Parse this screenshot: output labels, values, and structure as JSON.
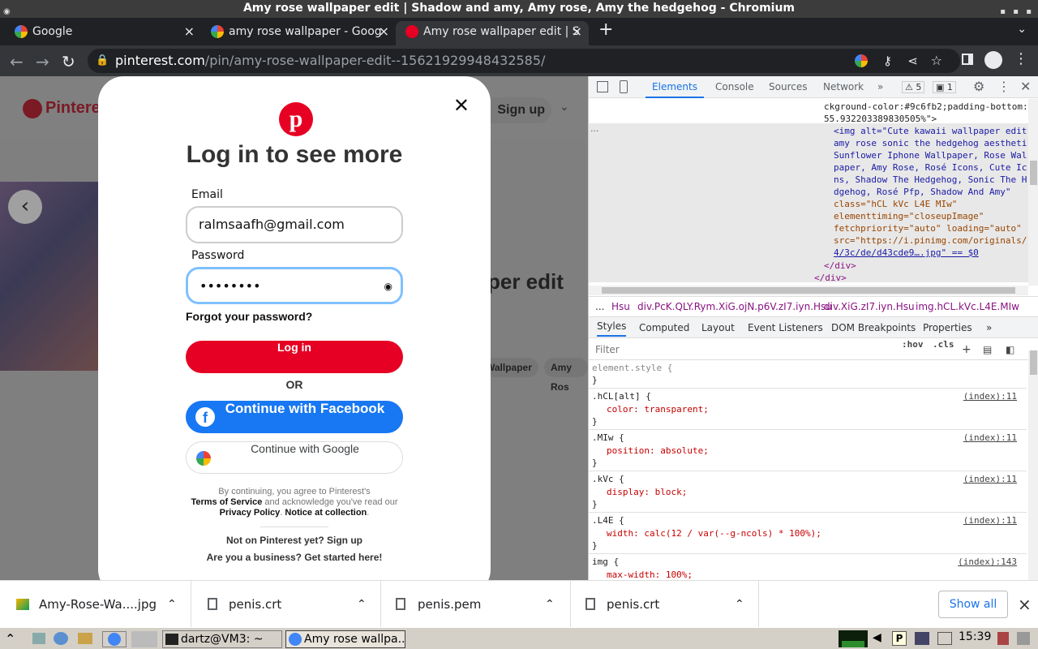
{
  "window": {
    "title": "Amy rose wallpaper edit | Shadow and amy, Amy rose, Amy the hedgehog - Chromium"
  },
  "tabs": [
    {
      "label": "Google",
      "close": "×"
    },
    {
      "label": "amy rose wallpaper - Goog",
      "close": "×"
    },
    {
      "label": "Amy rose wallpaper edit | S",
      "close": "×"
    }
  ],
  "toolbar": {
    "new_tab": "+",
    "url_domain": "pinterest.com",
    "url_path": "/pin/amy-rose-wallpaper-edit--15621929948432585/"
  },
  "page": {
    "brand": "Pinterest",
    "signup_button": "Sign up",
    "pin_title_fragment": "per edit",
    "chip_1": "Wallpaper",
    "chip_2": "Amy Ros"
  },
  "modal": {
    "close": "✕",
    "title": "Log in to see more",
    "email_label": "Email",
    "email_value": "ralmsaafh@gmail.com",
    "password_label": "Password",
    "password_value": "••••••••",
    "forgot": "Forgot your password?",
    "login_button": "Log in",
    "or": "OR",
    "facebook_button": "Continue with Facebook",
    "google_button": "Continue with Google",
    "terms_1": "By continuing, you agree to Pinterest's",
    "terms_2a": "Terms of Service",
    "terms_2b": " and acknowledge you've read our",
    "terms_3a": "Privacy Policy",
    "terms_3b": ". ",
    "terms_3c": "Notice at collection",
    "terms_3d": ".",
    "not_on": "Not on Pinterest yet? Sign up",
    "business": "Are you a business? Get started here!"
  },
  "devtools": {
    "tabs": [
      "Elements",
      "Console",
      "Sources",
      "Network"
    ],
    "more": "»",
    "warnings": "5",
    "issues": "1",
    "code_lines": [
      "ckground-color:#9c6fb2;padding-bottom:",
      "55.932203389830505%\">",
      "<img alt=\"Cute kawaii wallpaper edit",
      "amy rose sonic the hedgehog aestheti",
      "Sunflower Iphone Wallpaper, Rose Wal",
      "paper, Amy Rose, Rosé Icons, Cute Ic",
      "ns, Shadow The Hedgehog, Sonic The H",
      "dgehog, Rosé Pfp, Shadow And Amy\"",
      "class=\"hCL kVc L4E MIw\"",
      "elementtiming=\"closeupImage\"",
      "fetchpriority=\"auto\" loading=\"auto\"",
      "src=\"https://i.pinimg.com/originals/",
      "4/3c/de/d43cde9….jpg\" == $0",
      "</div>",
      "</div>"
    ],
    "breadcrumbs": [
      "... ",
      "Hsu",
      "div.PcK.QLY.Rym.XiG.ojN.p6V.zI7.iyn.Hsu",
      "div.XiG.zI7.iyn.Hsu",
      "img.hCL.kVc.L4E.MIw"
    ],
    "panel_tabs": [
      "Styles",
      "Computed",
      "Layout",
      "Event Listeners",
      "DOM Breakpoints",
      "Properties"
    ],
    "filter_placeholder": "Filter",
    "hov": ":hov",
    "cls": ".cls",
    "rules": [
      {
        "selector": "element.style {",
        "prop": "",
        "src": ""
      },
      {
        "selector": ".hCL[alt] {",
        "prop": "color: transparent;",
        "src": "(index):11"
      },
      {
        "selector": ".MIw {",
        "prop": "position: absolute;",
        "src": "(index):11"
      },
      {
        "selector": ".kVc {",
        "prop": "display: block;",
        "src": "(index):11"
      },
      {
        "selector": ".L4E {",
        "prop": "width: calc(12 / var(--g-ncols) * 100%);",
        "src": "(index):11"
      },
      {
        "selector": "img {",
        "prop": "max-width: 100%;",
        "src": "(index):143"
      }
    ],
    "close_brace": "}"
  },
  "downloads": {
    "items": [
      "Amy-Rose-Wa....jpg",
      "penis.crt",
      "penis.pem",
      "penis.crt"
    ],
    "show_all": "Show all",
    "close": "×"
  },
  "taskbar": {
    "terminal": "dartz@VM3: ~",
    "browser": "Amy rose wallpa...",
    "clock": "15:39"
  }
}
